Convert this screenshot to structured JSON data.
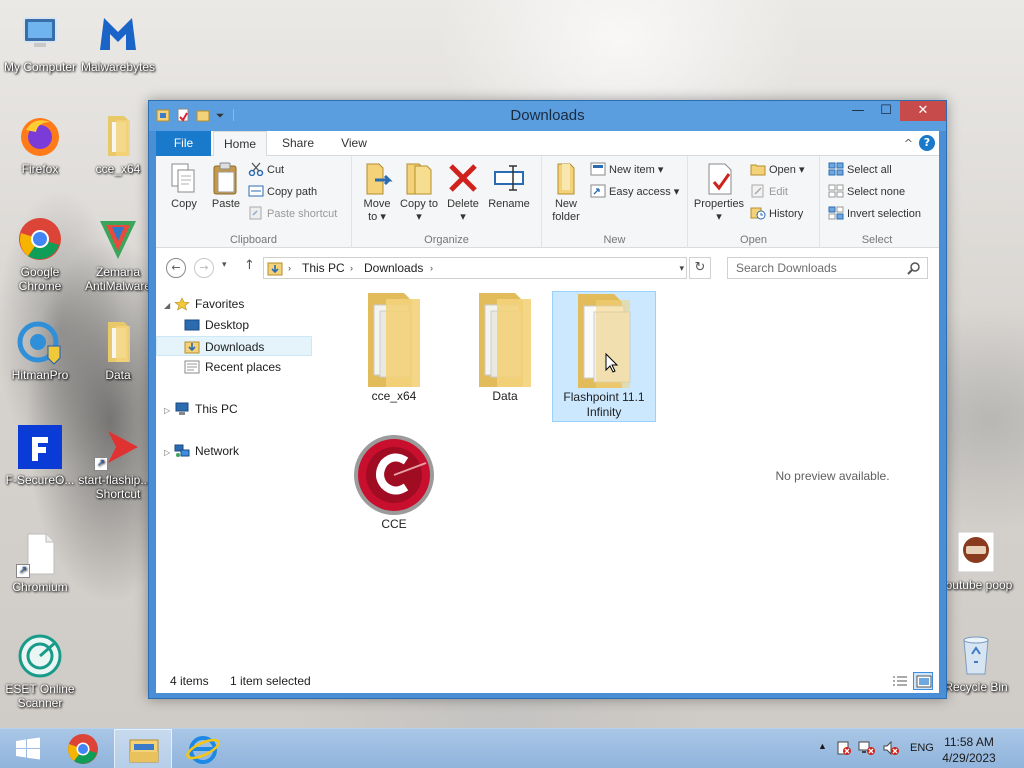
{
  "desktop": {
    "icons": [
      {
        "label": "My Computer"
      },
      {
        "label": "Malwarebytes"
      },
      {
        "label": "Firefox"
      },
      {
        "label": "cce_x64"
      },
      {
        "label": "Google Chrome"
      },
      {
        "label": "Zemana AntiMalware"
      },
      {
        "label": "HitmanPro"
      },
      {
        "label": "Data"
      },
      {
        "label": "F-SecureO..."
      },
      {
        "label": "start-flaship... - Shortcut"
      },
      {
        "label": "Chromium"
      },
      {
        "label": "ESET Online Scanner"
      },
      {
        "label": "youtube poop"
      },
      {
        "label": "Recycle Bin"
      }
    ]
  },
  "window": {
    "title": "Downloads",
    "close_glyph": "✕",
    "maximize_glyph": "☐",
    "minimize_glyph": "—"
  },
  "ribbon": {
    "tabs": {
      "file": "File",
      "home": "Home",
      "share": "Share",
      "view": "View"
    },
    "clipboard": {
      "label": "Clipboard",
      "copy": "Copy",
      "paste": "Paste",
      "cut": "Cut",
      "copy_path": "Copy path",
      "paste_shortcut": "Paste shortcut"
    },
    "organize": {
      "label": "Organize",
      "move_to": "Move to ▾",
      "copy_to": "Copy to ▾",
      "delete": "Delete",
      "delete_arrow": "▾",
      "rename": "Rename"
    },
    "new": {
      "label": "New",
      "new_folder": "New folder",
      "new_item": "New item ▾",
      "easy_access": "Easy access ▾"
    },
    "open": {
      "label": "Open",
      "properties": "Properties",
      "properties_arrow": "▾",
      "open": "Open ▾",
      "edit": "Edit",
      "history": "History"
    },
    "select": {
      "label": "Select",
      "select_all": "Select all",
      "select_none": "Select none",
      "invert_selection": "Invert selection"
    },
    "help_glyph": "?",
    "collapse_glyph": "^"
  },
  "navigation": {
    "back_glyph": "←",
    "forward_glyph": "→",
    "recent_glyph": "▾",
    "up_glyph": "↑",
    "breadcrumb": [
      "This PC",
      "Downloads"
    ],
    "sep_glyph": "›",
    "dropdown_glyph": "▾",
    "refresh_glyph": "↻",
    "search_placeholder": "Search Downloads"
  },
  "nav_pane": {
    "favorites": "Favorites",
    "desktop": "Desktop",
    "downloads": "Downloads",
    "recent_places": "Recent places",
    "this_pc": "This PC",
    "network": "Network",
    "expanded_glyph": "◢",
    "collapsed_glyph": "▷"
  },
  "files": [
    {
      "name": "cce_x64",
      "type": "folder",
      "selected": false
    },
    {
      "name": "Data",
      "type": "folder",
      "selected": false
    },
    {
      "name": "Flashpoint 11.1 Infinity",
      "type": "folder",
      "selected": true
    },
    {
      "name": "CCE",
      "type": "app",
      "selected": false
    }
  ],
  "preview": {
    "text": "No preview available."
  },
  "status": {
    "items": "4 items",
    "selection": "1 item selected"
  },
  "taskbar": {
    "lang": "ENG",
    "time": "11:58 AM",
    "date": "4/29/2023",
    "tray_arrow": "▲"
  },
  "colors": {
    "accent": "#1979ca",
    "titlebar": "#5a9ee0",
    "close": "#c74b4b",
    "selection": "#cce8ff",
    "folder": "#f3d27a"
  }
}
